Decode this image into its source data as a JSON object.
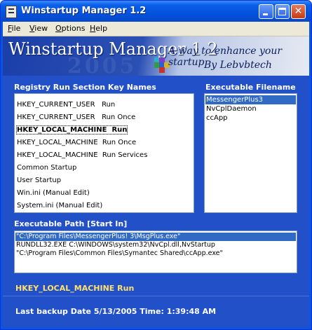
{
  "window": {
    "title": "Winstartup Manager 1.2",
    "controls": {
      "minimize": "minimize",
      "maximize": "maximize",
      "close": "✕"
    }
  },
  "menu": [
    "File",
    "View",
    "Options",
    "Help"
  ],
  "banner": {
    "title": "Winstartup Manager 1.2",
    "year": "2005",
    "tagline_line1": "A way to enhance your startup",
    "tagline_line2": "By Lebvbtech"
  },
  "registry": {
    "label": "Registry Run Section Key Names",
    "items": [
      "HKEY_CURRENT_USER   Run",
      "HKEY_CURRENT_USER   Run Once",
      "HKEY_LOCAL_MACHINE  Run",
      "HKEY_LOCAL_MACHINE  Run Once",
      "HKEY_LOCAL_MACHINE  Run Services",
      "Common Startup",
      "User Startup",
      "Win.ini (Manual Edit)",
      "System.ini (Manual Edit)"
    ],
    "selected_index": 2
  },
  "executables": {
    "label": "Executable Filename",
    "items": [
      "MessengerPlus3",
      "NvCplDaemon",
      "ccApp"
    ],
    "selected_index": 0
  },
  "paths": {
    "label": "Executable Path  [Start In]",
    "items": [
      "\"C:\\Program Files\\MessengerPlus! 3\\MsgPlus.exe\"",
      "RUNDLL32.EXE C:\\WINDOWS\\system32\\NvCpl.dll,NvStartup",
      "\"C:\\Program Files\\Common Files\\Symantec Shared\\ccApp.exe\""
    ],
    "selected_index": 0
  },
  "status": {
    "current_key": "HKEY_LOCAL_MACHINE  Run",
    "backup_text": "Last backup Date 5/13/2005 Time: 1:39:48 AM"
  },
  "colors": {
    "title_bar": "#0552de",
    "panel_bg": "#2250c8",
    "selection": "#316ac5",
    "status_key": "#ffe168"
  },
  "icons": [
    "app-icon",
    "cube-logo-icon",
    "minimize-icon",
    "maximize-icon",
    "close-icon"
  ]
}
